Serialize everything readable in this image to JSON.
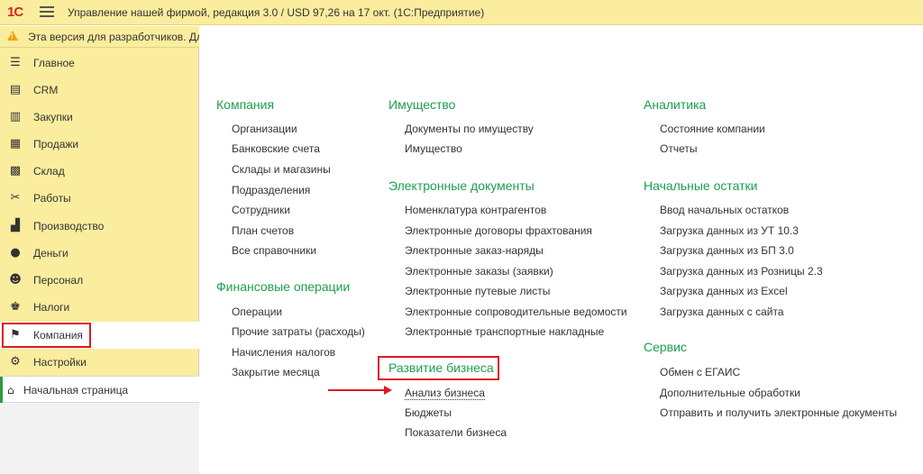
{
  "titlebar": {
    "logo": "1С",
    "title": "Управление нашей фирмой, редакция 3.0 / USD 97,26 на 17 окт.  (1С:Предприятие)"
  },
  "left": {
    "dev_warning": "Эта версия для разработчиков. Для",
    "nav": [
      {
        "label": "Главное",
        "icon": "menu-lines-icon"
      },
      {
        "label": "CRM",
        "icon": "contact-card-icon"
      },
      {
        "label": "Закупки",
        "icon": "purchases-icon"
      },
      {
        "label": "Продажи",
        "icon": "sales-basket-icon"
      },
      {
        "label": "Склад",
        "icon": "warehouse-grid-icon"
      },
      {
        "label": "Работы",
        "icon": "tools-icon"
      },
      {
        "label": "Производство",
        "icon": "factory-icon"
      },
      {
        "label": "Деньги",
        "icon": "coin-icon"
      },
      {
        "label": "Персонал",
        "icon": "people-icon"
      },
      {
        "label": "Налоги",
        "icon": "eagle-emblem-icon"
      },
      {
        "label": "Компания",
        "icon": "flag-icon",
        "active": true
      },
      {
        "label": "Настройки",
        "icon": "gear-icon"
      }
    ],
    "home": {
      "label": "Начальная страница",
      "icon": "home-icon"
    }
  },
  "content": {
    "company": {
      "title": "Компания",
      "links": [
        "Организации",
        "Банковские счета",
        "Склады и магазины",
        "Подразделения",
        "Сотрудники",
        "План счетов",
        "Все справочники"
      ]
    },
    "finance": {
      "title": "Финансовые операции",
      "links": [
        "Операции",
        "Прочие затраты (расходы)",
        "Начисления налогов",
        "Закрытие месяца"
      ]
    },
    "property": {
      "title": "Имущество",
      "links": [
        "Документы по имуществу",
        "Имущество"
      ]
    },
    "edocs": {
      "title": "Электронные документы",
      "links": [
        "Номенклатура контрагентов",
        "Электронные договоры фрахтования",
        "Электронные заказ-наряды",
        "Электронные заказы (заявки)",
        "Электронные путевые листы",
        "Электронные сопроводительные ведомости",
        "Электронные транспортные накладные"
      ]
    },
    "business": {
      "title": "Развитие бизнеса",
      "links": [
        "Анализ бизнеса",
        "Бюджеты",
        "Показатели бизнеса"
      ]
    },
    "analytics": {
      "title": "Аналитика",
      "links": [
        "Состояние компании",
        "Отчеты"
      ]
    },
    "balances": {
      "title": "Начальные остатки",
      "links": [
        "Ввод начальных остатков",
        "Загрузка данных из УТ 10.3",
        "Загрузка данных из БП 3.0",
        "Загрузка данных из Розницы 2.3",
        "Загрузка данных из Excel",
        "Загрузка данных с сайта"
      ]
    },
    "service": {
      "title": "Сервис",
      "links": [
        "Обмен с ЕГАИС",
        "Дополнительные обработки",
        "Отправить и получить электронные документы"
      ]
    }
  },
  "colors": {
    "accent_green": "#1d9e4d",
    "panel_yellow": "#fbed9e",
    "highlight_red": "#e0181e"
  }
}
